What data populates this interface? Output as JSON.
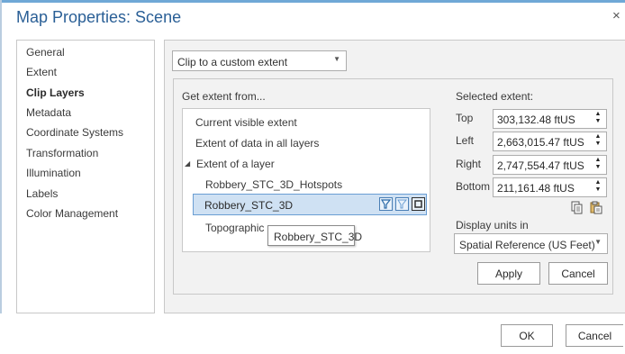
{
  "window": {
    "title": "Map Properties: Scene",
    "close_glyph": "×"
  },
  "nav": {
    "items": [
      {
        "label": "General",
        "selected": false
      },
      {
        "label": "Extent",
        "selected": false
      },
      {
        "label": "Clip Layers",
        "selected": true
      },
      {
        "label": "Metadata",
        "selected": false
      },
      {
        "label": "Coordinate Systems",
        "selected": false
      },
      {
        "label": "Transformation",
        "selected": false
      },
      {
        "label": "Illumination",
        "selected": false
      },
      {
        "label": "Labels",
        "selected": false
      },
      {
        "label": "Color Management",
        "selected": false
      }
    ]
  },
  "clip": {
    "mode_value": "Clip to a custom extent",
    "get_extent_label": "Get extent from...",
    "options": {
      "current_visible": "Current visible extent",
      "all_layers": "Extent of data in all layers",
      "of_a_layer": "Extent of a layer",
      "layer_hotspots": "Robbery_STC_3D_Hotspots",
      "layer_selected": "Robbery_STC_3D",
      "layer_topographic": "Topographic"
    },
    "tooltip": "Robbery_STC_3D",
    "selected_extent_label": "Selected extent:",
    "top_label": "Top",
    "top_value": "303,132.48 ftUS",
    "left_label": "Left",
    "left_value": "2,663,015.47 ftUS",
    "right_label": "Right",
    "right_value": "2,747,554.47 ftUS",
    "bottom_label": "Bottom",
    "bottom_value": "211,161.48 ftUS",
    "display_units_label": "Display units in",
    "display_units_value": "Spatial Reference (US Feet)",
    "apply_label": "Apply",
    "cancel_label": "Cancel"
  },
  "footer": {
    "ok_label": "OK",
    "cancel_label": "Cancel"
  },
  "colors": {
    "title": "#2a5f96",
    "selection_bg": "#cfe1f3",
    "selection_border": "#6a9ed3"
  }
}
